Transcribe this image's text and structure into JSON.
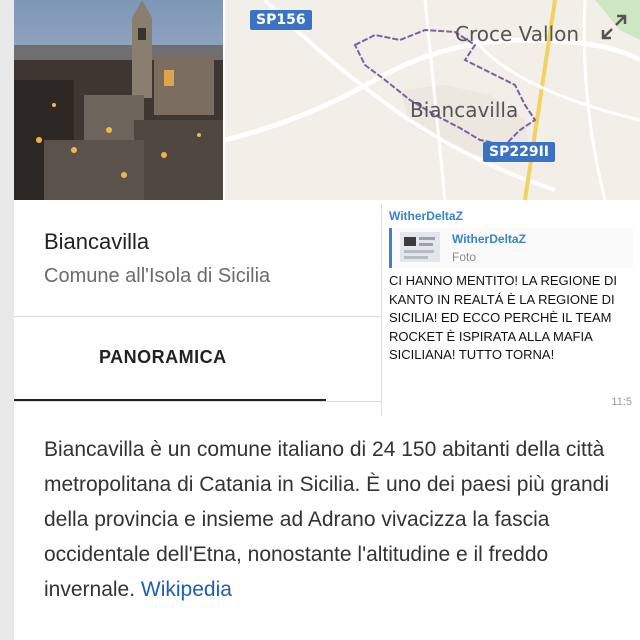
{
  "map": {
    "road_sp156": "SP156",
    "road_sp229": "SP229II",
    "label_croce": "Croce Vallon",
    "label_town": "Biancavilla",
    "expand_icon": "expand-icon"
  },
  "place": {
    "title": "Biancavilla",
    "subtitle": "Comune all'Isola di Sicilia"
  },
  "tabs": {
    "overview": "PANORAMICA"
  },
  "description": {
    "text": "Biancavilla è un comune italiano di 24 150 abitanti della città metropolitana di Catania in Sicilia. È uno dei paesi più grandi della provincia e insieme ad Adrano vivacizza la fascia occidentale dell'Etna, nonostante l'altitudine e il freddo invernale.",
    "link": "Wikipedia"
  },
  "chat": {
    "user": "WitherDeltaZ",
    "quote_user": "WitherDeltaZ",
    "quote_type": "Foto",
    "message": "CI HANNO MENTITO! LA REGIONE DI KANTO IN REALTÁ È LA REGIONE DI SICILIA! ED ECCO PERCHÈ IL TEAM ROCKET È ISPIRATA ALLA MAFIA SICILIANA! TUTTO TORNA!",
    "time": "11:5"
  },
  "colors": {
    "link_blue": "#1a5fb4",
    "road_shield": "#3a73c4",
    "boundary": "#7b5fa8",
    "chat_accent": "#3a83c7"
  }
}
